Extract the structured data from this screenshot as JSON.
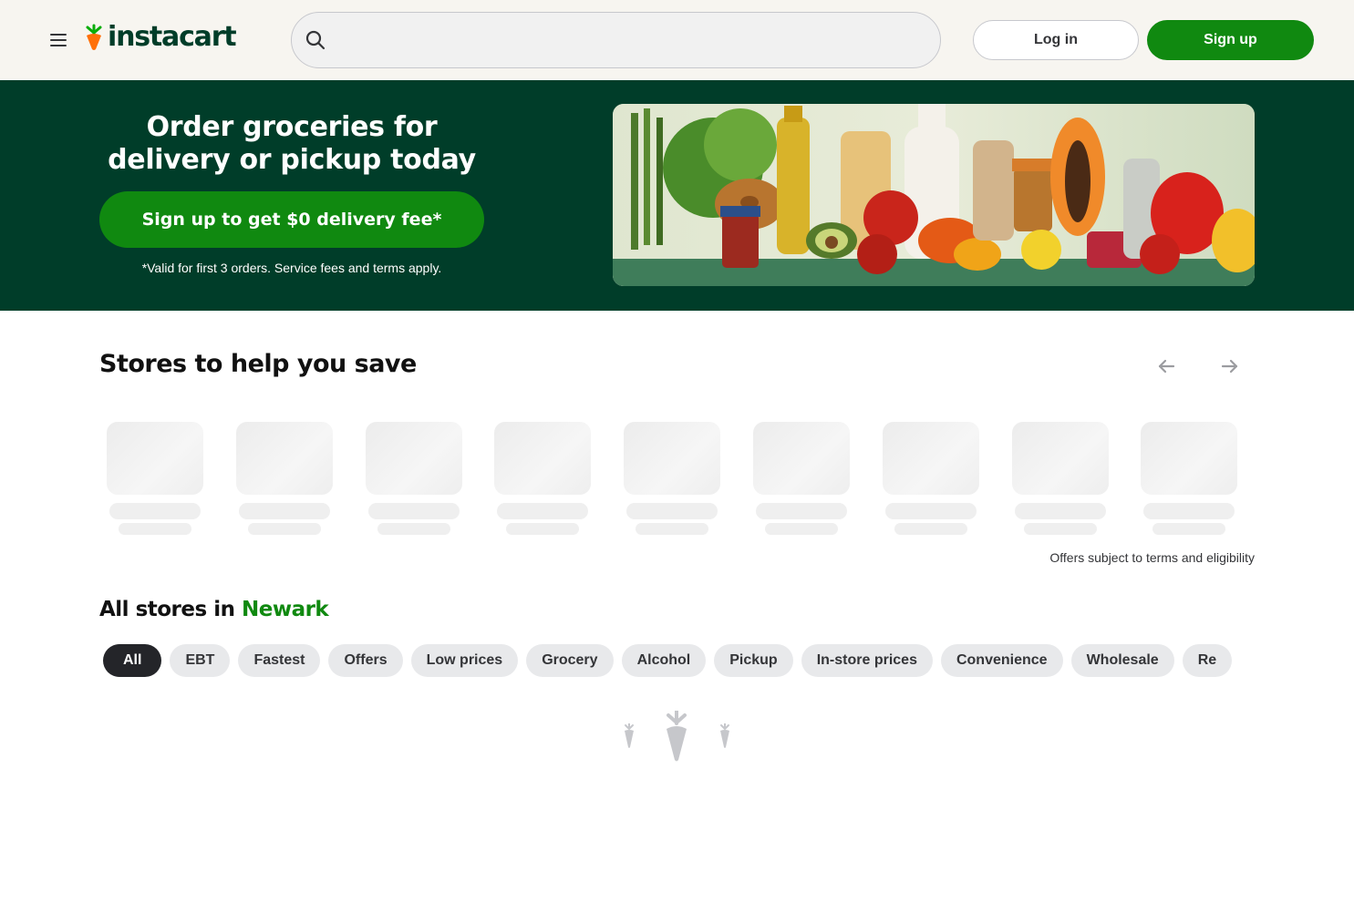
{
  "header": {
    "logo_text": "instacart",
    "search": {
      "value": "",
      "placeholder": ""
    },
    "login_label": "Log in",
    "signup_label": "Sign up"
  },
  "hero": {
    "title": "Order groceries for delivery or pickup today",
    "cta_label": "Sign up to get $0 delivery fee*",
    "note": "*Valid for first 3 orders. Service fees and terms apply."
  },
  "save_section": {
    "title": "Stores to help you save",
    "offers_note": "Offers subject to terms and eligibility",
    "placeholder_count": 9
  },
  "all_stores": {
    "title_prefix": "All stores in ",
    "city": "Newark",
    "chips": [
      "All",
      "EBT",
      "Fastest",
      "Offers",
      "Low prices",
      "Grocery",
      "Alcohol",
      "Pickup",
      "In-store prices",
      "Convenience",
      "Wholesale",
      "Re"
    ],
    "selected_chip": "All"
  },
  "colors": {
    "brand_green": "#108910",
    "dark_green": "#003d29",
    "logo_orange": "#ff7009",
    "header_bg": "#f7f5f0"
  },
  "icons": [
    "menu-icon",
    "carrot-logo-icon",
    "search-icon",
    "arrow-left-icon",
    "arrow-right-icon",
    "carrot-loader-icon"
  ]
}
